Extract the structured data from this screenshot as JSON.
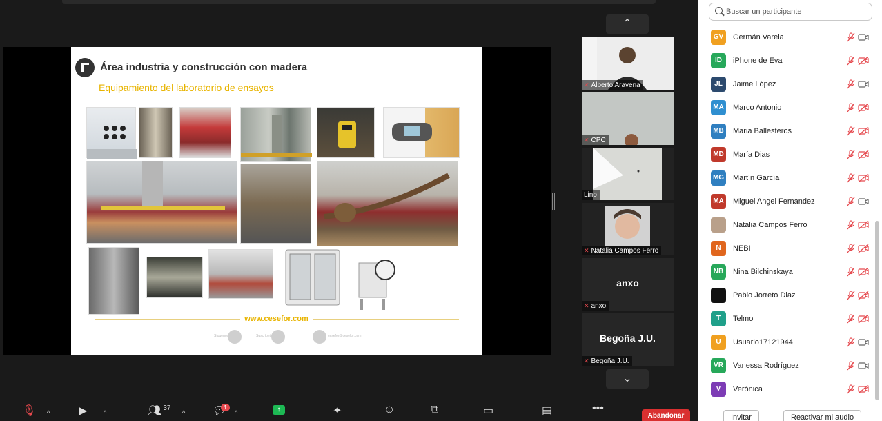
{
  "slide": {
    "title": "Área industria y construcción con madera",
    "subtitle": "Equipamiento del laboratorio de ensayos",
    "url": "www.cesefor.com",
    "social": [
      "Síguenos",
      "Suscríbete",
      "cesefor@cesefor.com"
    ]
  },
  "video_tiles": [
    {
      "name": "Alberto Aravena",
      "muted": true,
      "video": true
    },
    {
      "name": "CPC",
      "muted": true,
      "video": true
    },
    {
      "name": "Lino",
      "muted": false,
      "video": true
    },
    {
      "name": "Natalia Campos Ferro",
      "muted": true,
      "video": true
    },
    {
      "name": "anxo",
      "label": "anxo",
      "muted": true,
      "video": false
    },
    {
      "name": "Begoña J.U.",
      "label": "Begoña J.U.",
      "muted": true,
      "video": false
    }
  ],
  "search": {
    "placeholder": "Buscar un participante"
  },
  "participants": [
    {
      "initials": "GV",
      "name": "Germán Varela",
      "color": "#f0a020",
      "cam_on": true
    },
    {
      "initials": "ID",
      "name": "iPhone de Eva",
      "color": "#27a85a",
      "cam_on": false
    },
    {
      "initials": "JL",
      "name": "Jaime López",
      "color": "#2c4a6e",
      "cam_on": true
    },
    {
      "initials": "MA",
      "name": "Marco Antonio",
      "color": "#2f8fd0",
      "cam_on": false
    },
    {
      "initials": "MB",
      "name": "Maria Ballesteros",
      "color": "#2f7fc0",
      "cam_on": false
    },
    {
      "initials": "MD",
      "name": "María Dias",
      "color": "#c0392b",
      "cam_on": false
    },
    {
      "initials": "MG",
      "name": "Martín García",
      "color": "#2f7fc0",
      "cam_on": false
    },
    {
      "initials": "MA",
      "name": "Miguel Angel Fernandez",
      "color": "#c0392b",
      "cam_on": true
    },
    {
      "initials": "",
      "name": "Natalia Campos Ferro",
      "color": "#b9a08a",
      "cam_on": false
    },
    {
      "initials": "N",
      "name": "NEBI",
      "color": "#e0661e",
      "cam_on": false
    },
    {
      "initials": "NB",
      "name": "Nina Bilchinskaya",
      "color": "#27a85a",
      "cam_on": false
    },
    {
      "initials": "",
      "name": "Pablo Jorreto Diaz",
      "color": "#111111",
      "cam_on": false
    },
    {
      "initials": "T",
      "name": "Telmo",
      "color": "#1fa08a",
      "cam_on": false
    },
    {
      "initials": "U",
      "name": "Usuario17121944",
      "color": "#f0a020",
      "cam_on": true
    },
    {
      "initials": "VR",
      "name": "Vanessa Rodríguez",
      "color": "#27a85a",
      "cam_on": true
    },
    {
      "initials": "V",
      "name": "Verónica",
      "color": "#7d3cb5",
      "cam_on": false
    }
  ],
  "panel_buttons": {
    "invite": "Invitar",
    "unmute": "Reactivar mi audio"
  },
  "toolbar": {
    "participants_count": "37",
    "chat_badge": "1",
    "leave": "Abandonar"
  },
  "colors": {
    "muted_red": "#e5484d",
    "slide_accent": "#e8b400",
    "share_green": "#1db954",
    "leave_red": "#d93030"
  }
}
